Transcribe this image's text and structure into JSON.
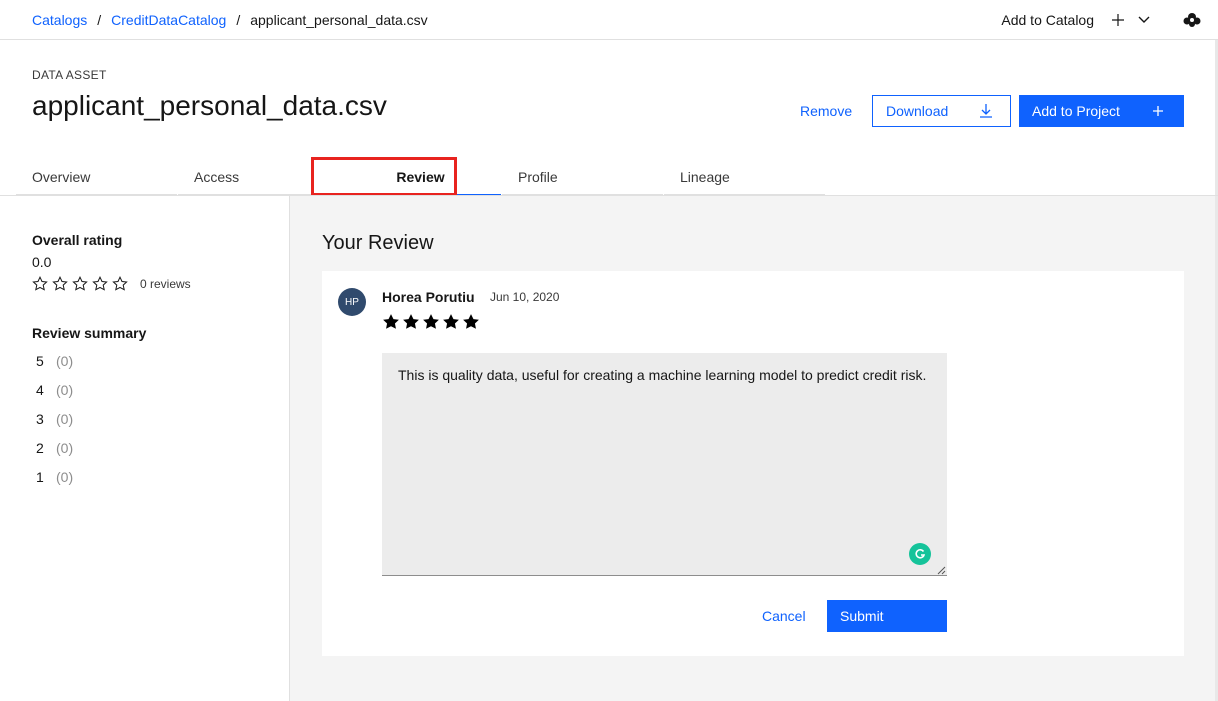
{
  "breadcrumb": {
    "items": [
      "Catalogs",
      "CreditDataCatalog"
    ],
    "current": "applicant_personal_data.csv",
    "separator": "/"
  },
  "topbar": {
    "add_to_catalog": "Add to Catalog",
    "icons": [
      "plus-icon",
      "chevron-down-icon",
      "cloud-icon"
    ]
  },
  "asset": {
    "type_label": "DATA ASSET",
    "title": "applicant_personal_data.csv"
  },
  "actions": {
    "remove": "Remove",
    "download": "Download",
    "add_to_project": "Add to Project"
  },
  "tabs": [
    {
      "label": "Overview"
    },
    {
      "label": "Access"
    },
    {
      "label": "Review",
      "active": true
    },
    {
      "label": "Profile"
    },
    {
      "label": "Lineage"
    }
  ],
  "sidebar": {
    "overall_rating_label": "Overall rating",
    "overall_rating_value": "0.0",
    "overall_stars": 0,
    "reviews_count": "0 reviews",
    "review_summary_label": "Review summary",
    "summary": [
      {
        "stars": "5",
        "count": "(0)"
      },
      {
        "stars": "4",
        "count": "(0)"
      },
      {
        "stars": "3",
        "count": "(0)"
      },
      {
        "stars": "2",
        "count": "(0)"
      },
      {
        "stars": "1",
        "count": "(0)"
      }
    ]
  },
  "review": {
    "heading": "Your Review",
    "avatar_initials": "HP",
    "reviewer_name": "Horea Porutiu",
    "date": "Jun 10, 2020",
    "stars": 5,
    "text": "This is quality data, useful for creating a machine learning model to predict credit risk.",
    "cancel": "Cancel",
    "submit": "Submit"
  },
  "colors": {
    "accent": "#0f62fe",
    "highlight": "#e8231f",
    "avatar_bg": "#304a6d",
    "grammarly": "#15c39a"
  }
}
